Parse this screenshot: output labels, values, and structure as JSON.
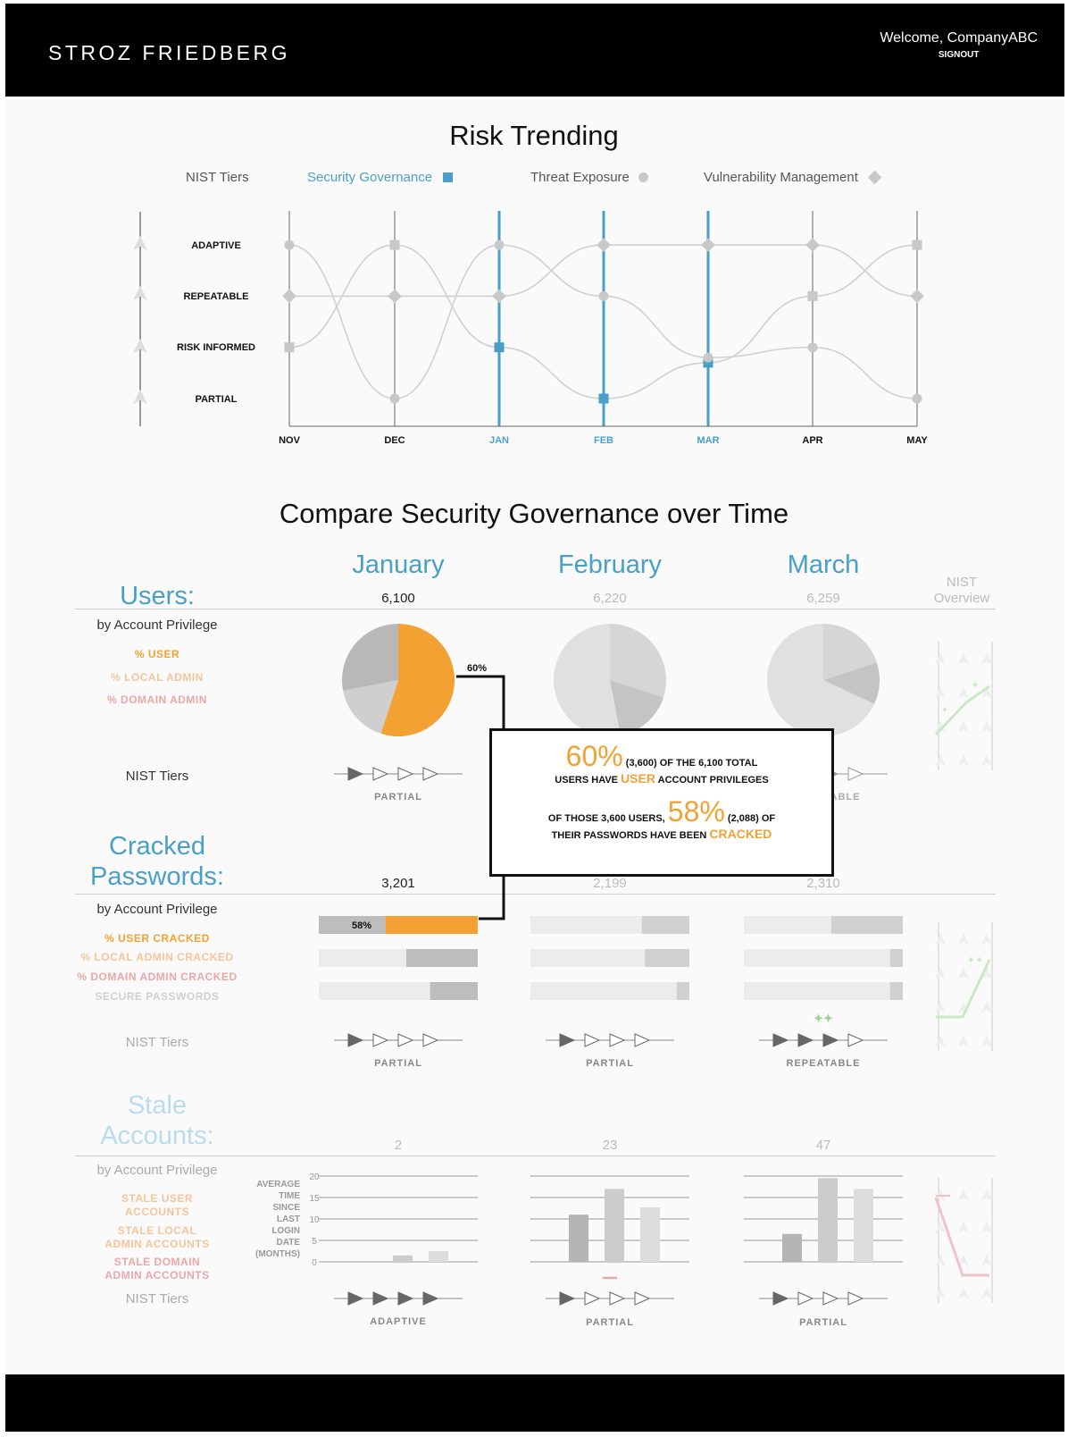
{
  "header": {
    "brand": "STROZ FRIEDBERG",
    "welcome": "Welcome, CompanyABC",
    "signout": "SIGNOUT"
  },
  "risk_trending": {
    "title": "Risk Trending",
    "legend": {
      "tiers": "NIST Tiers",
      "sg": "Security Governance",
      "te": "Threat Exposure",
      "vm": "Vulnerability Management"
    },
    "tiers": [
      "ADAPTIVE",
      "REPEATABLE",
      "RISK INFORMED",
      "PARTIAL"
    ],
    "months": [
      "NOV",
      "DEC",
      "JAN",
      "FEB",
      "MAR",
      "APR",
      "MAY"
    ],
    "highlighted_months": [
      "JAN",
      "FEB",
      "MAR"
    ],
    "colors": {
      "sg": "#4a9fc9",
      "grey": "#c8c8c8",
      "orange": "#f3a133"
    }
  },
  "chart_data": {
    "type": "line",
    "title": "Risk Trending",
    "x": [
      "NOV",
      "DEC",
      "JAN",
      "FEB",
      "MAR",
      "APR",
      "MAY"
    ],
    "y_levels": [
      "PARTIAL",
      "RISK INFORMED",
      "REPEATABLE",
      "ADAPTIVE"
    ],
    "series": [
      {
        "name": "Security Governance",
        "values": [
          2,
          4,
          2,
          1,
          1.7,
          3,
          4
        ]
      },
      {
        "name": "Threat Exposure",
        "values": [
          4,
          1,
          4,
          3,
          1.8,
          2,
          1
        ]
      },
      {
        "name": "Vulnerability Management",
        "values": [
          3,
          3,
          3,
          4,
          4,
          4,
          3
        ]
      }
    ]
  },
  "compare": {
    "title": "Compare Security Governance over Time",
    "months": [
      "January",
      "February",
      "March"
    ],
    "nist_overview": "NIST Overview",
    "users": {
      "title": "Users:",
      "sub": "by Account Privilege",
      "cats": [
        "% USER",
        "% LOCAL ADMIN",
        "% DOMAIN ADMIN"
      ],
      "counts": [
        "6,100",
        "6,220",
        "6,259"
      ],
      "callout": "60%",
      "nist_label": "NIST Tiers",
      "tiers": [
        "PARTIAL",
        "",
        "REPEATABLE"
      ]
    },
    "popup": {
      "pct1": "60%",
      "t1": "(3,600) OF THE 6,100 TOTAL",
      "t2a": "USERS HAVE",
      "hl1": "USER",
      "t2b": "ACCOUNT PRIVILEGES",
      "t3a": "OF THOSE 3,600 USERS,",
      "pct2": "58%",
      "t3b": "(2,088) OF",
      "t4a": "THEIR PASSWORDS HAVE BEEN",
      "hl2": "CRACKED"
    },
    "cracked": {
      "title_1": "Cracked",
      "title_2": "Passwords:",
      "sub": "by Account Privilege",
      "cats": [
        "% USER CRACKED",
        "% LOCAL ADMIN CRACKED",
        "% DOMAIN ADMIN CRACKED",
        "SECURE PASSWORDS"
      ],
      "counts": [
        "3,201",
        "2,199",
        "2,310"
      ],
      "bar_label": "58%",
      "nist_label": "NIST Tiers",
      "tiers": [
        "PARTIAL",
        "PARTIAL",
        "REPEATABLE"
      ],
      "fractions": [
        [
          0.58,
          0.3,
          0.45
        ],
        [
          0.45,
          0.28,
          0.08
        ],
        [
          0.3,
          0.08,
          0.08
        ]
      ]
    },
    "stale": {
      "title_1": "Stale",
      "title_2": "Accounts:",
      "sub": "by Account Privilege",
      "cats": [
        "STALE USER",
        "ACCOUNTS",
        "STALE LOCAL",
        "ADMIN ACCOUNTS",
        "STALE DOMAIN",
        "ADMIN ACCOUNTS"
      ],
      "counts": [
        "2",
        "23",
        "47"
      ],
      "axis_title": [
        "AVERAGE",
        "TIME",
        "SINCE",
        "LAST",
        "LOGIN",
        "DATE",
        "(MONTHS)"
      ],
      "ticks": [
        "20",
        "15",
        "10",
        "5",
        "0"
      ],
      "nist_label": "NIST Tiers",
      "tiers": [
        "ADAPTIVE",
        "PARTIAL",
        "PARTIAL"
      ],
      "values": [
        [
          0,
          1.5,
          2.5
        ],
        [
          11,
          17,
          12.7
        ],
        [
          6.5,
          19.5,
          17
        ]
      ]
    }
  }
}
